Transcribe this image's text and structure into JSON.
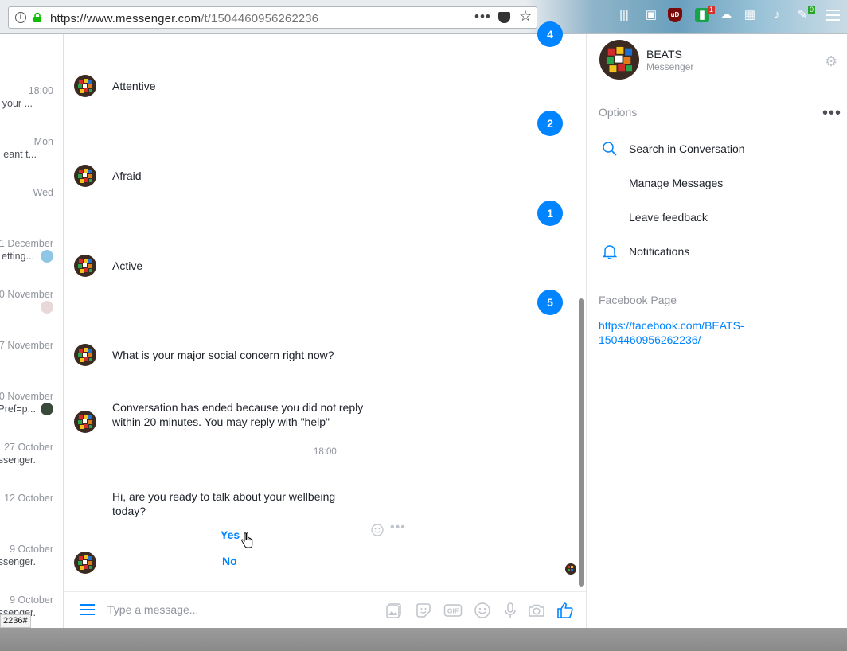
{
  "browser": {
    "url_host": "https://www.messenger.com",
    "url_path": "/t/1504460956262236",
    "page_actions": "•••",
    "status_url": "2236#",
    "extensions": [
      {
        "name": "ublock",
        "badge": ""
      },
      {
        "name": "badge-1",
        "badge": "1"
      },
      {
        "name": "badge-0",
        "badge": "0"
      }
    ]
  },
  "conversations": [
    {
      "time": "18:00",
      "snippet": "your ..."
    },
    {
      "time": "Mon",
      "snippet": "eant t..."
    },
    {
      "time": "Wed",
      "snippet": ""
    },
    {
      "time": "1 December",
      "snippet": "etting..."
    },
    {
      "time": "0 November",
      "snippet": ""
    },
    {
      "time": "7 November",
      "snippet": ""
    },
    {
      "time": "0 November",
      "snippet": "Pref=p..."
    },
    {
      "time": "27 October",
      "snippet": "ssenger."
    },
    {
      "time": "12 October",
      "snippet": ""
    },
    {
      "time": "9 October",
      "snippet": "ssenger."
    },
    {
      "time": "9 October",
      "snippet": "ssenger."
    }
  ],
  "chat": {
    "messages": [
      {
        "text": "Attentive"
      },
      {
        "text": "Afraid"
      },
      {
        "text": "Active"
      },
      {
        "text": "What is your major social concern right now?"
      },
      {
        "text": "Conversation has ended because you did not reply within 20 minutes. You may reply with \"help\""
      },
      {
        "text": "Hi,  are you ready to talk about your wellbeing today?"
      }
    ],
    "timestamp": "18:00",
    "quick_replies": [
      "Yes",
      "No"
    ],
    "number_badges": [
      "4",
      "2",
      "1",
      "5"
    ],
    "composer_placeholder": "Type a message..."
  },
  "info_panel": {
    "page_name": "BEATS",
    "page_sub": "Messenger",
    "options_heading": "Options",
    "options_more": "•••",
    "options": [
      "Search in Conversation",
      "Manage Messages",
      "Leave feedback",
      "Notifications"
    ],
    "facebook_heading": "Facebook Page",
    "facebook_link": "https://facebook.com/BEATS-1504460956262236/"
  },
  "colors": {
    "accent": "#0084ff",
    "muted": "#90949c",
    "text": "#1d2129"
  }
}
